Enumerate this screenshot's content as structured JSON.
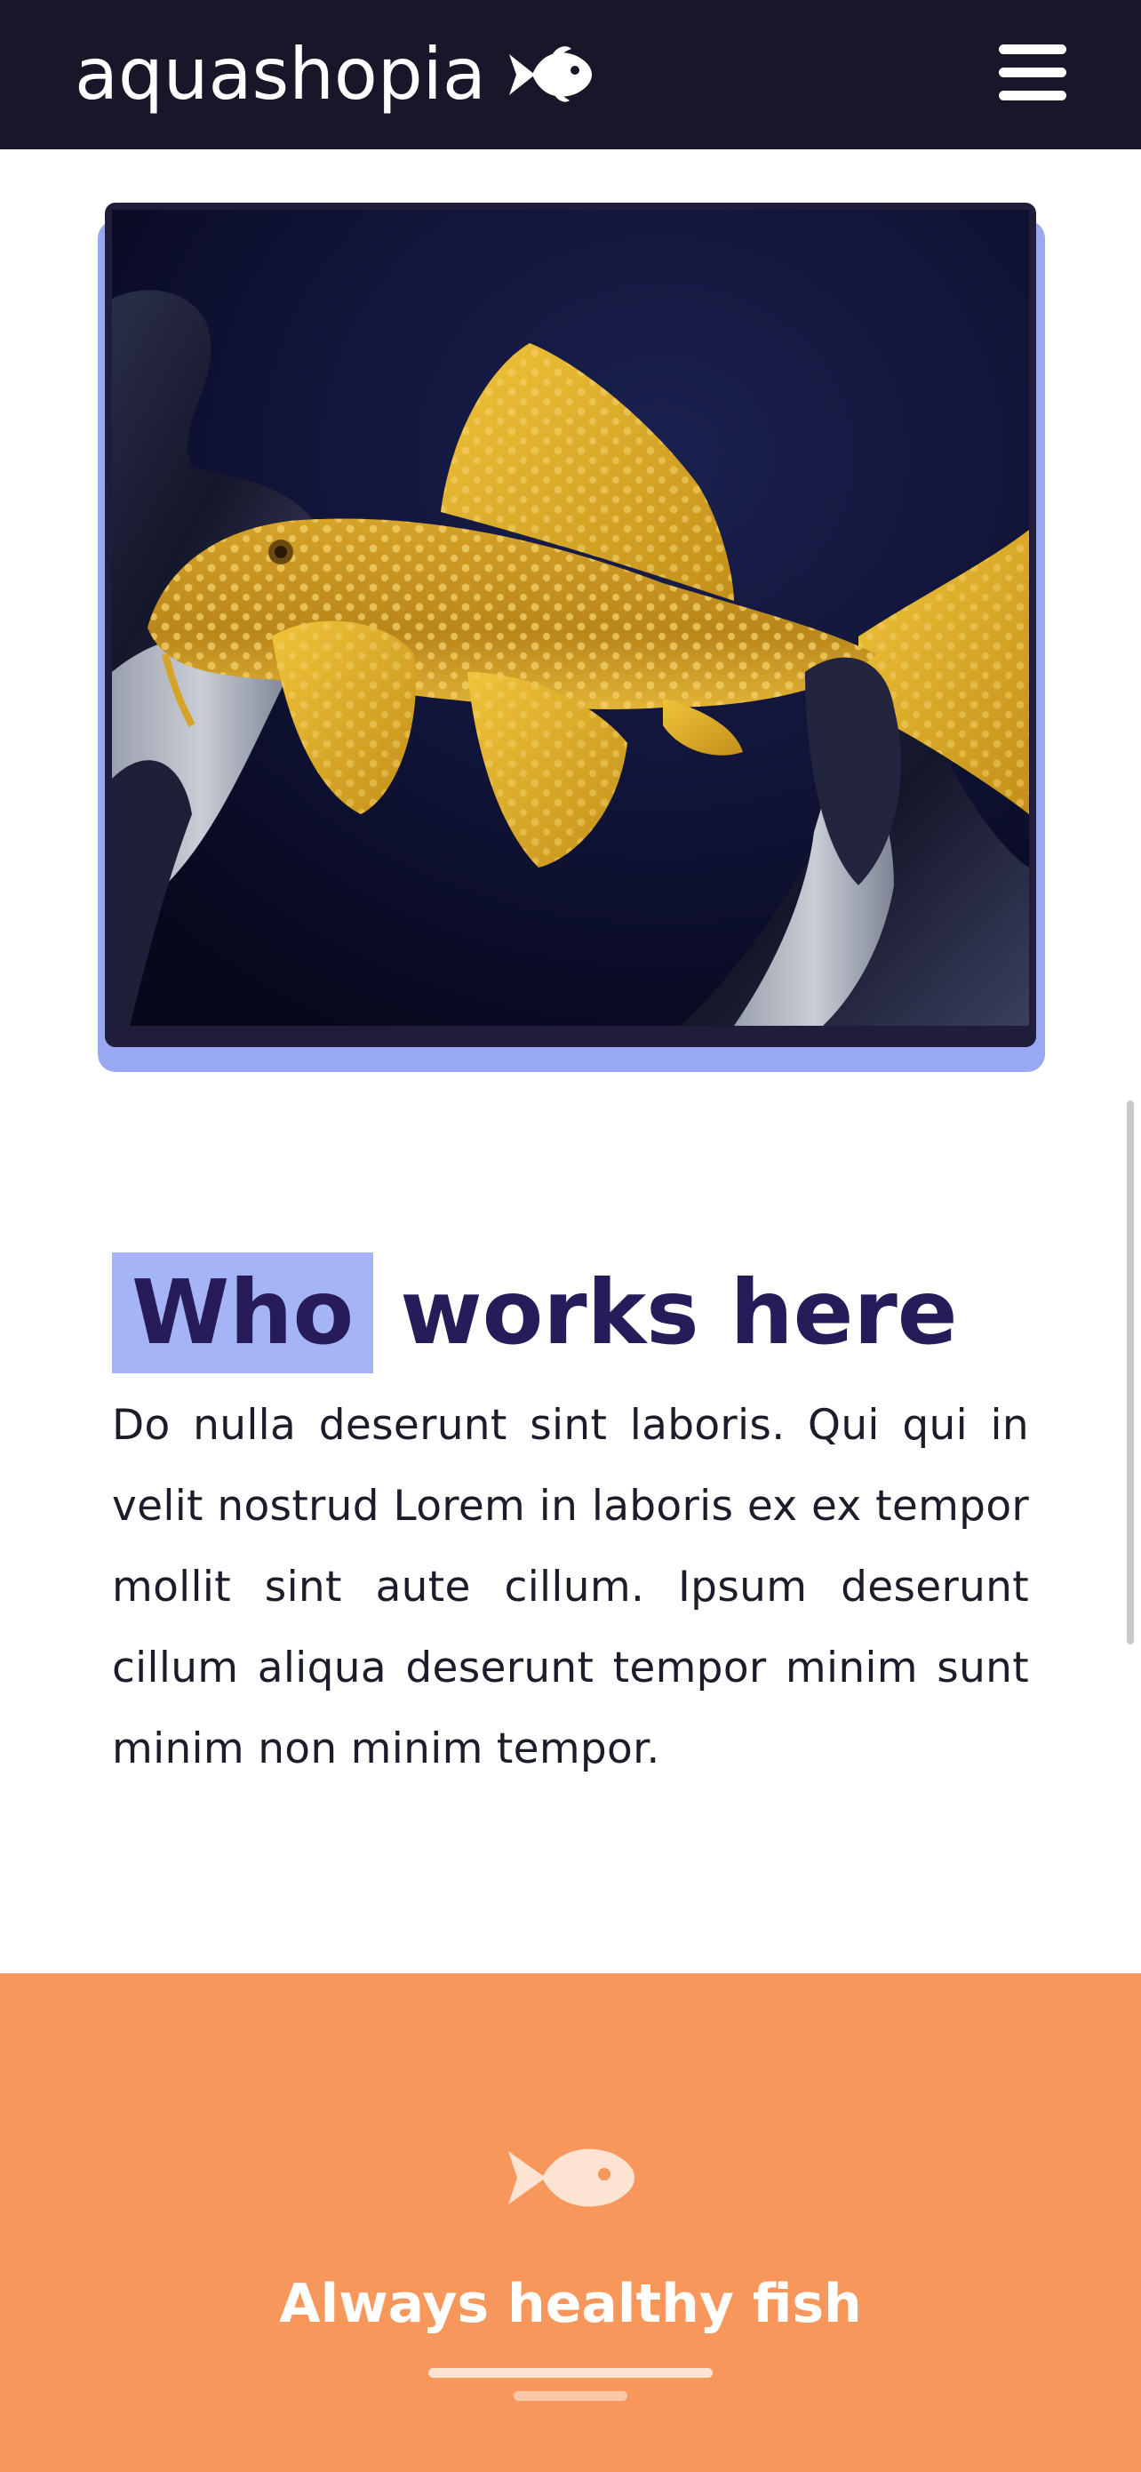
{
  "header": {
    "brand_name": "aquashopia",
    "brand_icon": "fish-icon",
    "menu_icon": "hamburger-menu-icon",
    "background": "#181629"
  },
  "hero_image": {
    "alt": "Golden pleco fish held by gloved hands",
    "accent_color": "#98a8f2"
  },
  "about": {
    "heading_highlight": "Who",
    "heading_rest": "works here",
    "heading_color": "#281b59",
    "highlight_color": "#a5b4f6",
    "body": "Do nulla deserunt sint laboris. Qui qui in velit nostrud Lorem in laboris ex ex tempor mollit sint aute cillum. Ipsum deserunt cillum aliqua deserunt tempor minim sunt minim non minim tempor."
  },
  "feature": {
    "icon": "fish-icon",
    "title": "Always healthy fish",
    "background": "#f7975c"
  }
}
